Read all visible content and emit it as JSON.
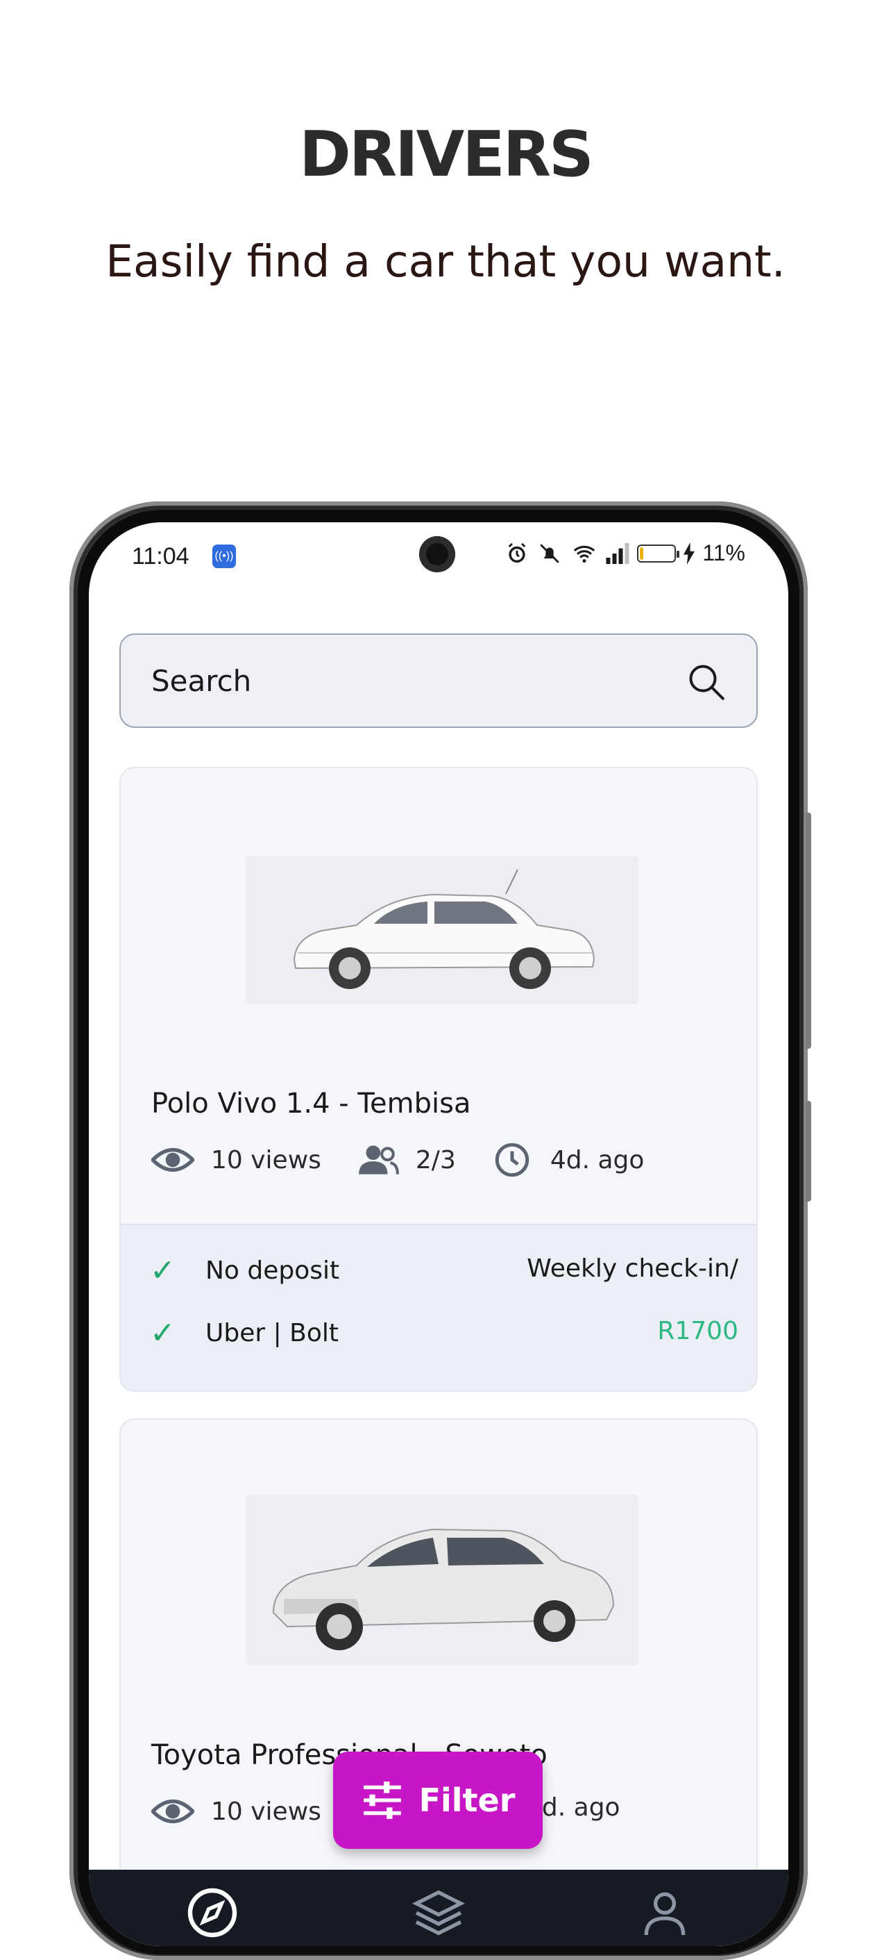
{
  "headline": "DRIVERS",
  "subline": "Easily find a car that you want.",
  "status_bar": {
    "time": "11:04",
    "battery_percent": "11%",
    "battery_level": 0.11,
    "icons": [
      "nfc-icon",
      "alarm-icon",
      "mute-icon",
      "wifi-icon",
      "signal-icon",
      "battery-icon",
      "charging-icon"
    ]
  },
  "search": {
    "placeholder": "Search"
  },
  "listings": [
    {
      "title": "Polo Vivo 1.4 - Tembisa",
      "views": "10 views",
      "occupancy": "2/3",
      "posted": "4d. ago",
      "features": [
        "No deposit",
        "Uber | Bolt"
      ],
      "checkin_label": "Weekly check-in/",
      "price": "R1700"
    },
    {
      "title": "Toyota Professional - Soweto",
      "views": "10 views",
      "posted": "4d. ago"
    }
  ],
  "filter_button": {
    "label": "Filter"
  },
  "bottom_nav": {
    "items": [
      "explore-icon",
      "layers-icon",
      "profile-icon"
    ]
  },
  "colors": {
    "accent": "#C616C6",
    "price": "#2BB882",
    "check": "#22A86A",
    "nav_bg": "#161A22"
  }
}
